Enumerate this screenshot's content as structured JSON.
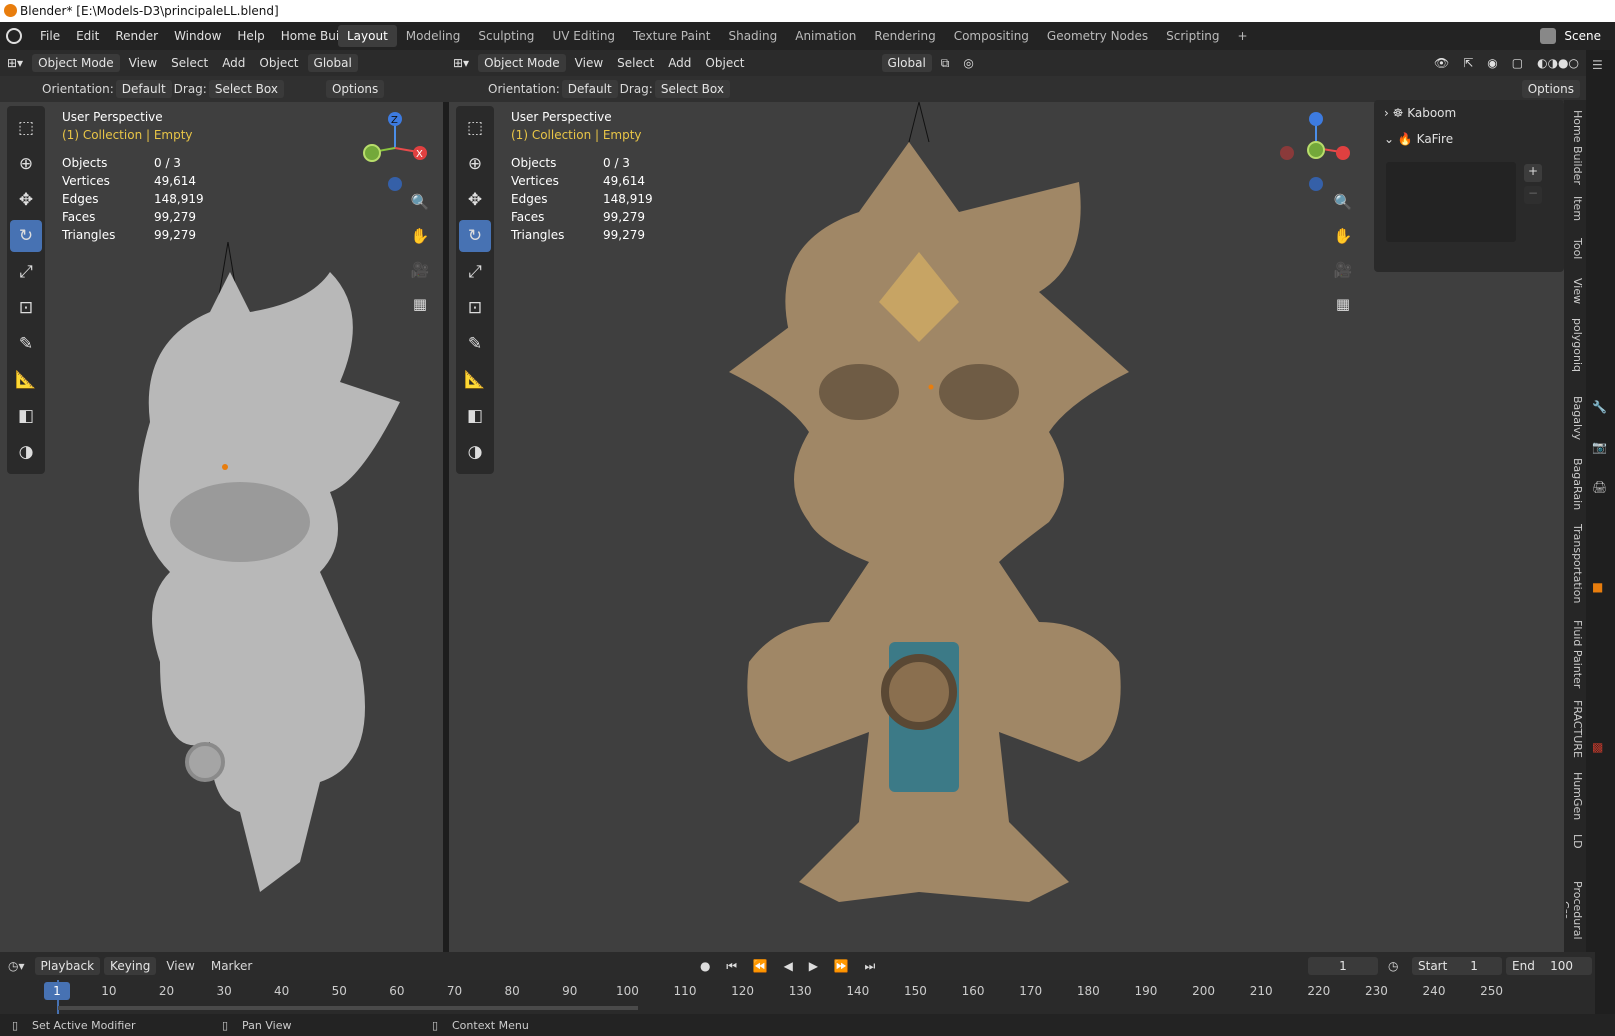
{
  "window_title": "Blender* [E:\\Models-D3\\principaleLL.blend]",
  "menu": [
    "File",
    "Edit",
    "Render",
    "Window",
    "Help",
    "Home Builder"
  ],
  "workspaces": [
    "Layout",
    "Modeling",
    "Sculpting",
    "UV Editing",
    "Texture Paint",
    "Shading",
    "Animation",
    "Rendering",
    "Compositing",
    "Geometry Nodes",
    "Scripting"
  ],
  "active_workspace": "Layout",
  "scene_label": "Scene",
  "left_viewport": {
    "mode": "Object Mode",
    "menus": [
      "View",
      "Select",
      "Add",
      "Object"
    ],
    "transform": "Global",
    "orientation_label": "Orientation:",
    "orientation": "Default",
    "drag_label": "Drag:",
    "drag": "Select Box",
    "options": "Options",
    "perspective": "User Perspective",
    "collection": "(1) Collection | Empty",
    "stats": {
      "objects_label": "Objects",
      "objects": "0 / 3",
      "vertices_label": "Vertices",
      "vertices": "49,614",
      "edges_label": "Edges",
      "edges": "148,919",
      "faces_label": "Faces",
      "faces": "99,279",
      "triangles_label": "Triangles",
      "triangles": "99,279"
    }
  },
  "right_viewport": {
    "mode": "Object Mode",
    "menus": [
      "View",
      "Select",
      "Add",
      "Object"
    ],
    "transform": "Global",
    "orientation_label": "Orientation:",
    "orientation": "Default",
    "drag_label": "Drag:",
    "drag": "Select Box",
    "options": "Options",
    "perspective": "User Perspective",
    "collection": "(1) Collection | Empty",
    "stats": {
      "objects_label": "Objects",
      "objects": "0 / 3",
      "vertices_label": "Vertices",
      "vertices": "49,614",
      "edges_label": "Edges",
      "edges": "148,919",
      "faces_label": "Faces",
      "faces": "99,279",
      "triangles_label": "Triangles",
      "triangles": "99,279"
    }
  },
  "npanel": {
    "items": [
      "Kaboom",
      "KaFire"
    ]
  },
  "side_tabs": [
    "Home Builder",
    "Item",
    "Tool",
    "View",
    "polygoniq",
    "Bagalvy",
    "BagaRain",
    "Transportation",
    "Fluid Painter",
    "FRACTURE",
    "HumGen",
    "LD",
    "Procedural Cro"
  ],
  "gizmo_axes": {
    "x": "X",
    "y": "Y",
    "z": "Z"
  },
  "timeline": {
    "menus": [
      "Playback",
      "Keying",
      "View",
      "Marker"
    ],
    "current_frame": "1",
    "start_label": "Start",
    "start": "1",
    "end_label": "End",
    "end": "100",
    "ticks": [
      "1",
      "10",
      "20",
      "30",
      "40",
      "50",
      "60",
      "70",
      "80",
      "90",
      "100",
      "110",
      "120",
      "130",
      "140",
      "150",
      "160",
      "170",
      "180",
      "190",
      "200",
      "210",
      "220",
      "230",
      "240",
      "250"
    ]
  },
  "statusbar": [
    "Set Active Modifier",
    "Pan View",
    "Context Menu"
  ],
  "colors": {
    "accent": "#4772b3",
    "collection": "#e8c547",
    "viewport": "#3f3f3f"
  }
}
